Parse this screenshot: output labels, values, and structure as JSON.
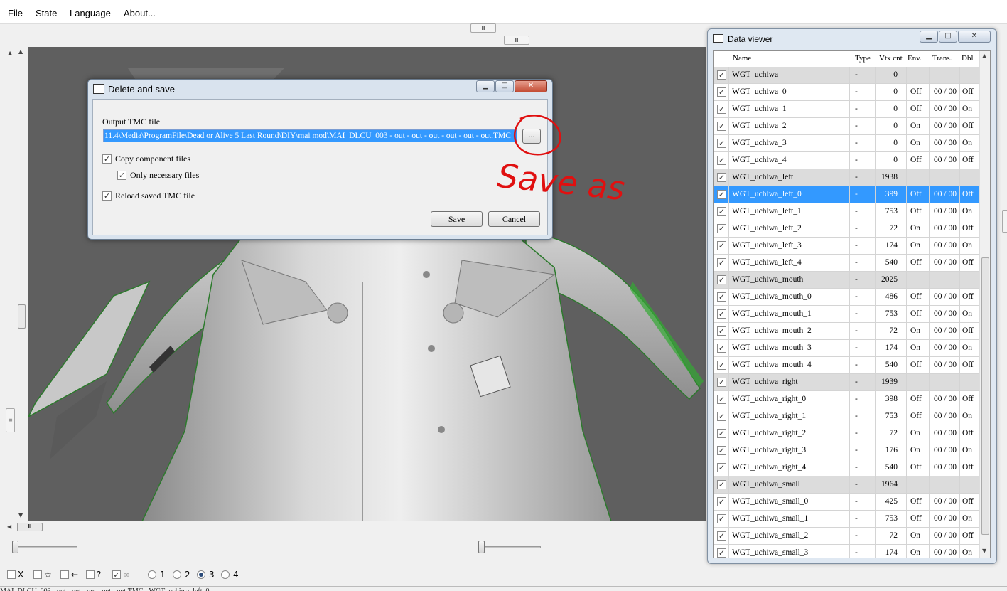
{
  "menu": {
    "items": [
      "File",
      "State",
      "Language",
      "About..."
    ]
  },
  "dialog": {
    "title": "Delete and save",
    "output_label": "Output TMC file",
    "output_path": "11.4\\Media\\ProgramFile\\Dead or Alive 5 Last Round\\DIY\\mai mod\\MAI_DLCU_003 - out - out - out - out - out - out.TMC",
    "browse_label": "...",
    "copy_component_label": "Copy component files",
    "only_necessary_label": "Only necessary files",
    "reload_label": "Reload saved TMC file",
    "copy_component_checked": true,
    "only_necessary_checked": true,
    "reload_checked": true,
    "save_label": "Save",
    "cancel_label": "Cancel"
  },
  "annotation": {
    "text": "Save as",
    "color": "#e01010"
  },
  "data_viewer": {
    "title": "Data viewer",
    "columns": [
      "Name",
      "Type",
      "Vtx cnt",
      "Env.",
      "Trans.",
      "Dbl"
    ],
    "selected_row": 7,
    "rows": [
      {
        "name": "WGT_uchiwa",
        "type": "-",
        "vtx": "0",
        "env": "",
        "trans": "",
        "dbl": "",
        "group": true
      },
      {
        "name": "WGT_uchiwa_0",
        "type": "-",
        "vtx": "0",
        "env": "Off",
        "trans": "00 / 00",
        "dbl": "Off",
        "group": false
      },
      {
        "name": "WGT_uchiwa_1",
        "type": "-",
        "vtx": "0",
        "env": "Off",
        "trans": "00 / 00",
        "dbl": "On",
        "group": false
      },
      {
        "name": "WGT_uchiwa_2",
        "type": "-",
        "vtx": "0",
        "env": "On",
        "trans": "00 / 00",
        "dbl": "Off",
        "group": false
      },
      {
        "name": "WGT_uchiwa_3",
        "type": "-",
        "vtx": "0",
        "env": "On",
        "trans": "00 / 00",
        "dbl": "On",
        "group": false
      },
      {
        "name": "WGT_uchiwa_4",
        "type": "-",
        "vtx": "0",
        "env": "Off",
        "trans": "00 / 00",
        "dbl": "Off",
        "group": false
      },
      {
        "name": "WGT_uchiwa_left",
        "type": "-",
        "vtx": "1938",
        "env": "",
        "trans": "",
        "dbl": "",
        "group": true
      },
      {
        "name": "WGT_uchiwa_left_0",
        "type": "-",
        "vtx": "399",
        "env": "Off",
        "trans": "00 / 00",
        "dbl": "Off",
        "group": false
      },
      {
        "name": "WGT_uchiwa_left_1",
        "type": "-",
        "vtx": "753",
        "env": "Off",
        "trans": "00 / 00",
        "dbl": "On",
        "group": false
      },
      {
        "name": "WGT_uchiwa_left_2",
        "type": "-",
        "vtx": "72",
        "env": "On",
        "trans": "00 / 00",
        "dbl": "Off",
        "group": false
      },
      {
        "name": "WGT_uchiwa_left_3",
        "type": "-",
        "vtx": "174",
        "env": "On",
        "trans": "00 / 00",
        "dbl": "On",
        "group": false
      },
      {
        "name": "WGT_uchiwa_left_4",
        "type": "-",
        "vtx": "540",
        "env": "Off",
        "trans": "00 / 00",
        "dbl": "Off",
        "group": false
      },
      {
        "name": "WGT_uchiwa_mouth",
        "type": "-",
        "vtx": "2025",
        "env": "",
        "trans": "",
        "dbl": "",
        "group": true
      },
      {
        "name": "WGT_uchiwa_mouth_0",
        "type": "-",
        "vtx": "486",
        "env": "Off",
        "trans": "00 / 00",
        "dbl": "Off",
        "group": false
      },
      {
        "name": "WGT_uchiwa_mouth_1",
        "type": "-",
        "vtx": "753",
        "env": "Off",
        "trans": "00 / 00",
        "dbl": "On",
        "group": false
      },
      {
        "name": "WGT_uchiwa_mouth_2",
        "type": "-",
        "vtx": "72",
        "env": "On",
        "trans": "00 / 00",
        "dbl": "Off",
        "group": false
      },
      {
        "name": "WGT_uchiwa_mouth_3",
        "type": "-",
        "vtx": "174",
        "env": "On",
        "trans": "00 / 00",
        "dbl": "On",
        "group": false
      },
      {
        "name": "WGT_uchiwa_mouth_4",
        "type": "-",
        "vtx": "540",
        "env": "Off",
        "trans": "00 / 00",
        "dbl": "Off",
        "group": false
      },
      {
        "name": "WGT_uchiwa_right",
        "type": "-",
        "vtx": "1939",
        "env": "",
        "trans": "",
        "dbl": "",
        "group": true
      },
      {
        "name": "WGT_uchiwa_right_0",
        "type": "-",
        "vtx": "398",
        "env": "Off",
        "trans": "00 / 00",
        "dbl": "Off",
        "group": false
      },
      {
        "name": "WGT_uchiwa_right_1",
        "type": "-",
        "vtx": "753",
        "env": "Off",
        "trans": "00 / 00",
        "dbl": "On",
        "group": false
      },
      {
        "name": "WGT_uchiwa_right_2",
        "type": "-",
        "vtx": "72",
        "env": "On",
        "trans": "00 / 00",
        "dbl": "Off",
        "group": false
      },
      {
        "name": "WGT_uchiwa_right_3",
        "type": "-",
        "vtx": "176",
        "env": "On",
        "trans": "00 / 00",
        "dbl": "On",
        "group": false
      },
      {
        "name": "WGT_uchiwa_right_4",
        "type": "-",
        "vtx": "540",
        "env": "Off",
        "trans": "00 / 00",
        "dbl": "Off",
        "group": false
      },
      {
        "name": "WGT_uchiwa_small",
        "type": "-",
        "vtx": "1964",
        "env": "",
        "trans": "",
        "dbl": "",
        "group": true
      },
      {
        "name": "WGT_uchiwa_small_0",
        "type": "-",
        "vtx": "425",
        "env": "Off",
        "trans": "00 / 00",
        "dbl": "Off",
        "group": false
      },
      {
        "name": "WGT_uchiwa_small_1",
        "type": "-",
        "vtx": "753",
        "env": "Off",
        "trans": "00 / 00",
        "dbl": "On",
        "group": false
      },
      {
        "name": "WGT_uchiwa_small_2",
        "type": "-",
        "vtx": "72",
        "env": "On",
        "trans": "00 / 00",
        "dbl": "Off",
        "group": false
      },
      {
        "name": "WGT_uchiwa_small_3",
        "type": "-",
        "vtx": "174",
        "env": "On",
        "trans": "00 / 00",
        "dbl": "On",
        "group": false
      }
    ]
  },
  "bottom_toolbar": {
    "toggles": [
      {
        "label": "X",
        "checked": false
      },
      {
        "label": "☆",
        "checked": false
      },
      {
        "label": "←",
        "checked": false
      },
      {
        "label": "?",
        "checked": false
      },
      {
        "label": "∞",
        "checked": true
      }
    ],
    "radios": [
      "1",
      "2",
      "3",
      "4"
    ],
    "radio_selected": "3"
  },
  "status_text": "MAI_DLCU_003 - out - out - out - out - out.TMC - WGT_uchiwa_left_0"
}
